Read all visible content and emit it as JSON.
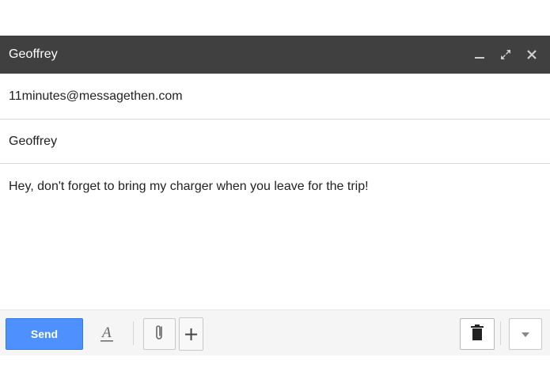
{
  "window": {
    "title": "Geoffrey",
    "controls": {
      "minimize_icon": "minimize-icon",
      "expand_icon": "expand-icon",
      "close_icon": "close-icon"
    }
  },
  "fields": {
    "to": "11minutes@messagethen.com",
    "subject": "Geoffrey"
  },
  "body": {
    "text": "Hey, don't forget to bring my charger when you leave for the trip!"
  },
  "toolbar": {
    "send_label": "Send",
    "icons": [
      "format-text-icon",
      "attach-icon",
      "plus-icon",
      "trash-icon",
      "dropdown-arrow-icon"
    ]
  },
  "colors": {
    "titlebar": "#404040",
    "send_button": "#4d90fe",
    "toolbar_bg": "#f5f5f5"
  }
}
